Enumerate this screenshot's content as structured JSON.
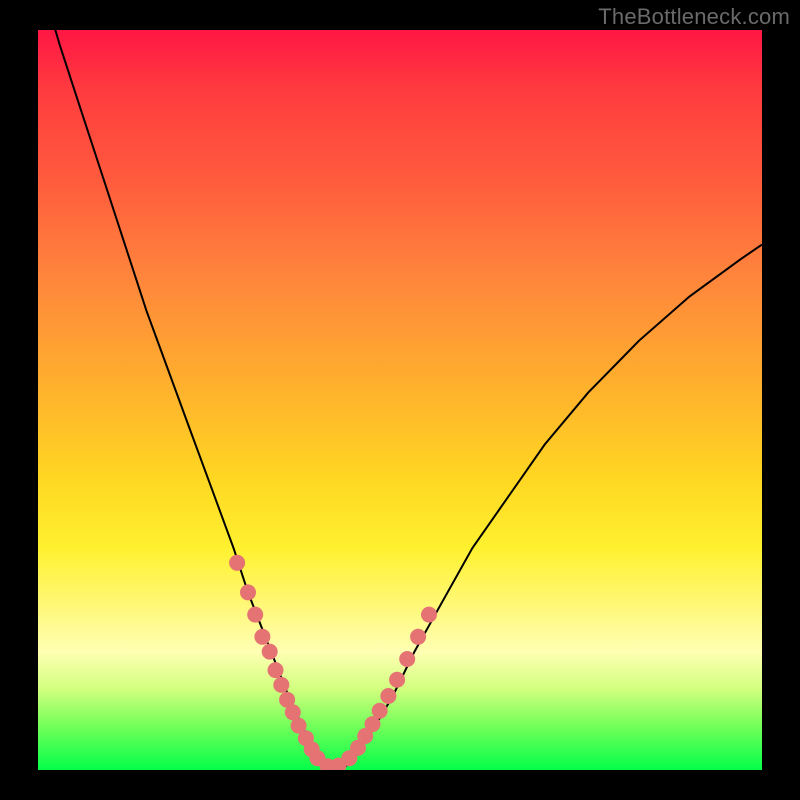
{
  "watermark": "TheBottleneck.com",
  "chart_data": {
    "type": "line",
    "title": "",
    "xlabel": "",
    "ylabel": "",
    "xlim": [
      0,
      100
    ],
    "ylim": [
      0,
      100
    ],
    "series": [
      {
        "name": "bottleneck-curve",
        "x": [
          0,
          3,
          6,
          9,
          12,
          15,
          18,
          21,
          24,
          27,
          29,
          31,
          33,
          35,
          37,
          38.5,
          40,
          42,
          44,
          46,
          49,
          52,
          56,
          60,
          65,
          70,
          76,
          83,
          90,
          97,
          100
        ],
        "y": [
          108,
          98,
          89,
          80,
          71,
          62,
          54,
          46,
          38,
          30,
          24,
          19,
          14,
          9,
          5,
          2,
          0,
          0,
          2,
          5,
          10,
          16,
          23,
          30,
          37,
          44,
          51,
          58,
          64,
          69,
          71
        ]
      }
    ],
    "markers": {
      "name": "highlight-points",
      "color": "#e57373",
      "x": [
        27.5,
        29,
        30,
        31,
        32,
        32.8,
        33.6,
        34.4,
        35.2,
        36,
        37,
        37.8,
        38.6,
        40,
        41.5,
        43,
        44.2,
        45.2,
        46.2,
        47.2,
        48.4,
        49.6,
        51,
        52.5,
        54
      ],
      "y": [
        28,
        24,
        21,
        18,
        16,
        13.5,
        11.5,
        9.5,
        7.8,
        6,
        4.3,
        2.8,
        1.6,
        0.5,
        0.6,
        1.6,
        3,
        4.6,
        6.2,
        8,
        10,
        12.2,
        15,
        18,
        21
      ]
    },
    "gradient_stops": [
      {
        "pos": 0,
        "color": "#ff1744"
      },
      {
        "pos": 20,
        "color": "#ff5a3d"
      },
      {
        "pos": 48,
        "color": "#ffb02d"
      },
      {
        "pos": 70,
        "color": "#fff12f"
      },
      {
        "pos": 89,
        "color": "#d2ff7f"
      },
      {
        "pos": 100,
        "color": "#03ff49"
      }
    ]
  }
}
